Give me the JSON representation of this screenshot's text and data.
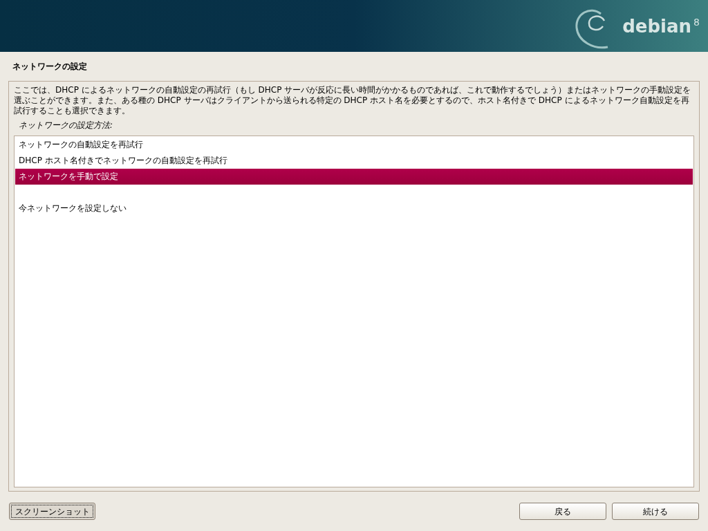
{
  "banner": {
    "logo_text": "debian",
    "version": "8"
  },
  "title": "ネットワークの設定",
  "description": "ここでは、DHCP によるネットワークの自動設定の再試行（もし DHCP サーバが反応に長い時間がかかるものであれば、これで動作するでしょう）またはネットワークの手動設定を選ぶことができます。また、ある種の DHCP サーバはクライアントから送られる特定の DHCP ホスト名を必要とするので、ホスト名付きで DHCP によるネットワーク自動設定を再試行することも選択できます。",
  "prompt": "ネットワークの設定方法:",
  "options": [
    {
      "kind": "option",
      "label": "ネットワークの自動設定を再試行",
      "selected": false
    },
    {
      "kind": "option",
      "label": "DHCP ホスト名付きでネットワークの自動設定を再試行",
      "selected": false
    },
    {
      "kind": "option",
      "label": "ネットワークを手動で設定",
      "selected": true
    },
    {
      "kind": "blank"
    },
    {
      "kind": "option",
      "label": "今ネットワークを設定しない",
      "selected": false
    }
  ],
  "buttons": {
    "screenshot": "スクリーンショット",
    "back": "戻る",
    "continue": "続ける"
  }
}
